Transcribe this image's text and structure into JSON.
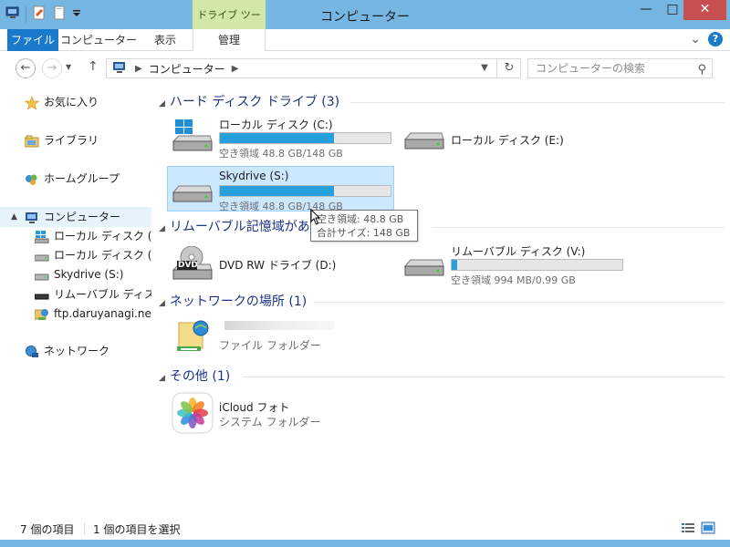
{
  "window": {
    "title": "コンピューター",
    "context_tab": "ドライブ ツール",
    "minimize": "—",
    "maximize": "□",
    "close": "✕"
  },
  "ribbon": {
    "tabs": [
      "ファイル",
      "コンピューター",
      "表示",
      "管理"
    ],
    "help": "?",
    "expand": "⌄"
  },
  "nav": {
    "back": "←",
    "forward": "→",
    "up": "↑",
    "address": "コンピューター",
    "search_placeholder": "コンピューターの検索"
  },
  "sidebar": {
    "favorites": "お気に入り",
    "libraries": "ライブラリ",
    "homegroup": "ホームグループ",
    "computer": "コンピューター",
    "drives": [
      "ローカル ディスク (C:)",
      "ローカル ディスク (E:)",
      "Skydrive (S:)",
      "リムーバブル ディスク (V",
      "ftp.daruyanagi.net"
    ],
    "network": "ネットワーク"
  },
  "groups": {
    "hard_disks": "ハード ディスク ドライブ (3)",
    "removable": "リムーバブル記憶域がある",
    "network_locations": "ネットワークの場所 (1)",
    "other": "その他 (1)"
  },
  "items": {
    "c_drive": {
      "name": "ローカル ディスク (C:)",
      "sub": "空き領域 48.8 GB/148 GB",
      "fill": 0.67
    },
    "e_drive": {
      "name": "ローカル ディスク (E:)"
    },
    "s_drive": {
      "name": "Skydrive (S:)",
      "sub": "空き領域 48.8 GB/148 GB",
      "fill": 0.67
    },
    "dvd_drive": {
      "name": "DVD RW ドライブ (D:)",
      "badge": "DVD"
    },
    "v_drive": {
      "name": "リムーバブル ディスク (V:)",
      "sub": "空き領域 994 MB/0.99 GB",
      "fill": 0.03
    },
    "ftp": {
      "sub": "ファイル フォルダー"
    },
    "icloud": {
      "name": "iCloud フォト",
      "sub": "システム フォルダー"
    }
  },
  "tooltip": {
    "free": "空き領域: 48.8 GB",
    "total": "合計サイズ: 148 GB"
  },
  "status": {
    "item_count": "7 個の項目",
    "selected": "1 個の項目を選択"
  },
  "colors": {
    "frame": "#76b6e2",
    "file_tab": "#1979ca",
    "context_tab": "#d3e7a7",
    "bar_fill": "#26a0da",
    "selection": "#cce8ff",
    "group_header": "#1e3287"
  }
}
